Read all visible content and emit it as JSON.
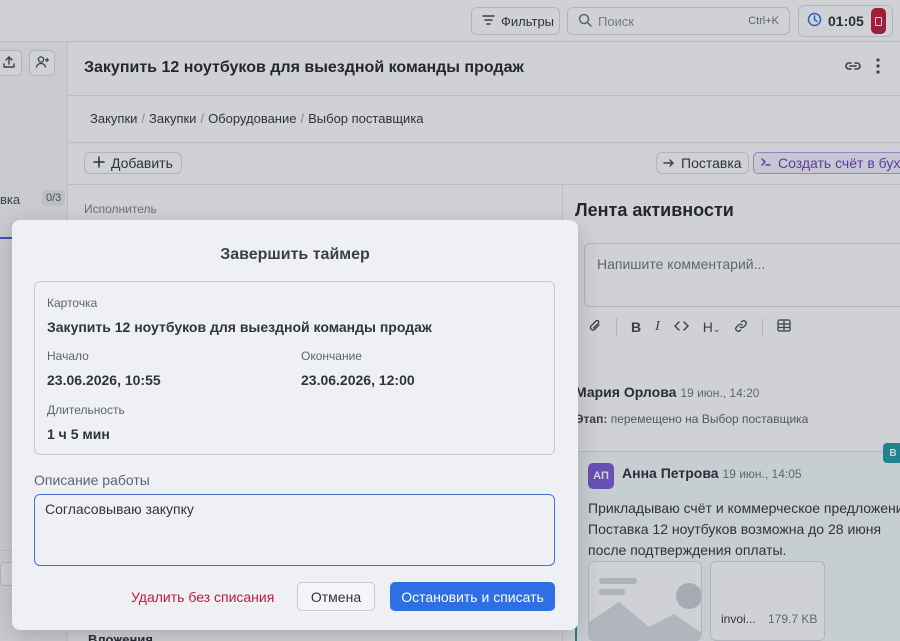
{
  "topbar": {
    "filters_label": "Фильтры",
    "search_placeholder": "Поиск",
    "search_shortcut": "Ctrl+K",
    "timer_value": "01:05"
  },
  "leftpanel": {
    "item_label": "вка",
    "item_count": "0/3"
  },
  "card": {
    "title": "Закупить 12 ноутбуков для выездной команды продаж",
    "breadcrumbs": [
      "Закупки",
      "Закупки",
      "Оборудование",
      "Выбор поставщика"
    ],
    "add_label": "Добавить",
    "ship_label": "Поставка",
    "invoice_label": "Создать счёт в бухг",
    "executor_label": "Исполнитель",
    "attachments_label": "Вложения"
  },
  "feed": {
    "title": "Лента активности",
    "comment_placeholder": "Напишите комментарий...",
    "entries": [
      {
        "author": "Мария Орлова",
        "time": "19 июн., 14:20",
        "stage_label": "Этап:",
        "stage_text": "перемещено на",
        "stage_value": "Выбор поставщика"
      },
      {
        "author": "Анна Петрова",
        "initials": "АП",
        "time": "19 июн., 14:05",
        "badge": "В",
        "text": "Прикладываю счёт и коммерческое предложение. Поставка 12 ноутбуков возможна до 28 июня после подтверждения оплаты.",
        "file_name": "invoi...",
        "file_size": "179.7 KB"
      }
    ]
  },
  "modal": {
    "title": "Завершить таймер",
    "card_label": "Карточка",
    "card_value": "Закупить 12 ноутбуков для выездной команды продаж",
    "start_label": "Начало",
    "start_value": "23.06.2026, 10:55",
    "end_label": "Окончание",
    "end_value": "23.06.2026, 12:00",
    "duration_label": "Длительность",
    "duration_value": "1 ч 5 мин",
    "description_label": "Описание работы",
    "description_value": "Согласовываю закупку",
    "delete_label": "Удалить без списания",
    "cancel_label": "Отмена",
    "stop_label": "Остановить и списать"
  }
}
